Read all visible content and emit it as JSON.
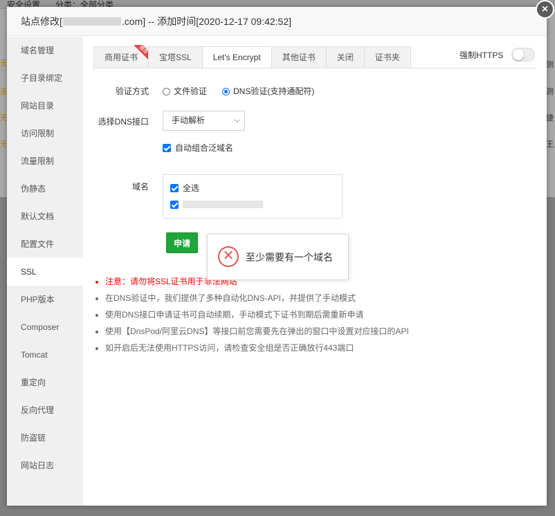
{
  "background": {
    "header_left": "安全设置",
    "header_mid": "分类：全部分类",
    "row_label": "无",
    "right_snippets": [
      "n(测",
      "n(测",
      "数捷",
      "n(王"
    ]
  },
  "dialog": {
    "title_prefix": "站点修改[",
    "title_domain_suffix": ".com]",
    "title_suffix": " -- 添加时间[2020-12-17 09:42:52]",
    "close_label": "×"
  },
  "sidebar": {
    "items": [
      {
        "label": "域名管理"
      },
      {
        "label": "子目录绑定"
      },
      {
        "label": "网站目录"
      },
      {
        "label": "访问限制"
      },
      {
        "label": "流量限制"
      },
      {
        "label": "伪静态"
      },
      {
        "label": "默认文档"
      },
      {
        "label": "配置文件"
      },
      {
        "label": "SSL"
      },
      {
        "label": "PHP版本"
      },
      {
        "label": "Composer"
      },
      {
        "label": "Tomcat"
      },
      {
        "label": "重定向"
      },
      {
        "label": "反向代理"
      },
      {
        "label": "防盗链"
      },
      {
        "label": "网站日志"
      }
    ],
    "active_index": 8
  },
  "tabs": {
    "items": [
      {
        "label": "商用证书",
        "badge": "推荐"
      },
      {
        "label": "宝塔SSL"
      },
      {
        "label": "Let's Encrypt"
      },
      {
        "label": "其他证书"
      },
      {
        "label": "关闭"
      },
      {
        "label": "证书夹"
      }
    ],
    "active_index": 2
  },
  "force_https": {
    "label": "强制HTTPS",
    "enabled": false
  },
  "form": {
    "verify_label": "验证方式",
    "verify_options": [
      "文件验证",
      "DNS验证(支持通配符)"
    ],
    "verify_selected": "DNS验证(支持通配符)",
    "dns_label": "选择DNS接口",
    "dns_selected": "手动解析",
    "auto_wildcard_label": "自动组合泛域名",
    "domain_label": "域名",
    "select_all_label": "全选",
    "apply_label": "申请"
  },
  "toast": {
    "message": "至少需要有一个域名"
  },
  "notes": [
    "注意：请勿将SSL证书用于非法网站",
    "在DNS验证中，我们提供了多种自动化DNS-API，并提供了手动模式",
    "使用DNS接口申请证书可自动续期，手动模式下证书到期后需重新申请",
    "使用【DnsPod/阿里云DNS】等接口前您需要先在弹出的窗口中设置对应接口的API",
    "如开启后无法使用HTTPS访问，请检查安全组是否正确放行443端口"
  ],
  "colors": {
    "accent_green": "#20a53a",
    "error_red": "#e2534d",
    "warning_red": "#ff0000",
    "check_blue": "#0075ff"
  }
}
